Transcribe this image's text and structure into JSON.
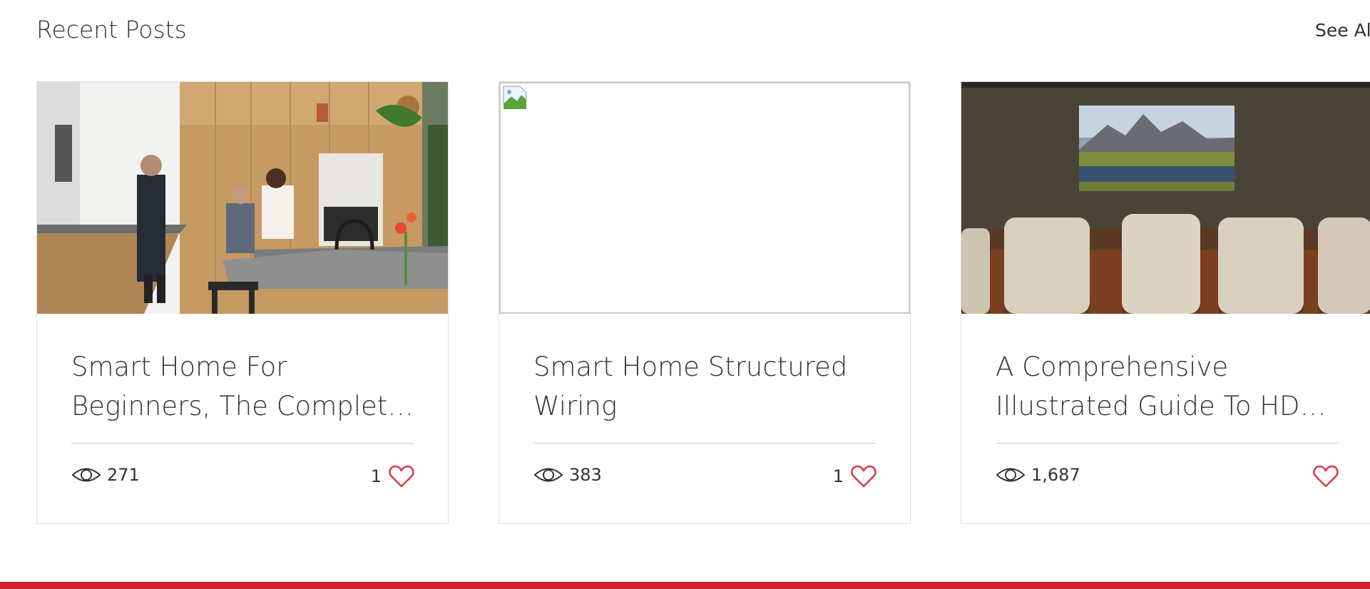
{
  "header": {
    "title": "Recent Posts",
    "see_all_label": "See All"
  },
  "colors": {
    "accent_red": "#d0202e",
    "heart_red": "#e03a44",
    "divider": "#c9c9c9"
  },
  "posts": [
    {
      "title": "Smart Home For Beginners, The Complete Guide",
      "views": "271",
      "likes": "1",
      "image": "kitchen-family-photo",
      "views_icon": "eye-icon",
      "like_icon": "heart-outline-icon"
    },
    {
      "title": "Smart Home Structured Wiring",
      "views": "383",
      "likes": "1",
      "image": "broken-image-icon",
      "views_icon": "eye-icon",
      "like_icon": "heart-outline-icon"
    },
    {
      "title": "A Comprehensive Illustrated Guide To HDMI Cables",
      "views": "1,687",
      "likes": "",
      "image": "home-theater-photo",
      "views_icon": "eye-icon",
      "like_icon": "heart-outline-icon"
    }
  ]
}
